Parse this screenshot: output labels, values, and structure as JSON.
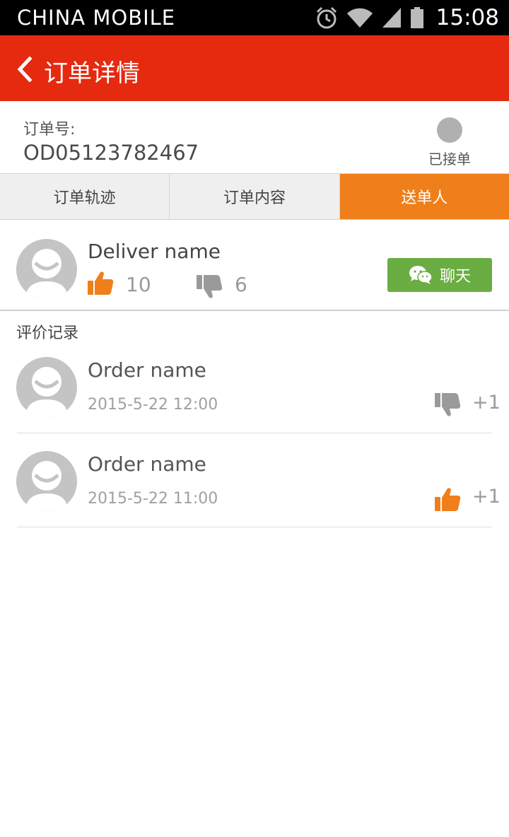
{
  "status_bar": {
    "carrier": "CHINA  MOBILE",
    "time": "15:08",
    "icons": [
      "alarm-icon",
      "wifi-icon",
      "signal-icon",
      "battery-icon"
    ]
  },
  "app_bar": {
    "title": "订单详情",
    "back_icon": "chevron-left-icon",
    "color": "#e52a10"
  },
  "order": {
    "label": "订单号:",
    "number": "OD05123782467",
    "status": "已接单"
  },
  "tabs": [
    {
      "label": "订单轨迹",
      "active": false
    },
    {
      "label": "订单内容",
      "active": false
    },
    {
      "label": "送单人",
      "active": true
    }
  ],
  "tab_active_color": "#ef7f1a",
  "deliverer": {
    "name": "Deliver name",
    "likes": "10",
    "dislikes": "6",
    "chat_label": "聊天",
    "chat_color": "#6aad42"
  },
  "reviews": {
    "title": "评价记录",
    "items": [
      {
        "name": "Order name",
        "time": "2015-5-22  12:00",
        "rating": "dislike",
        "score": "+1"
      },
      {
        "name": "Order name",
        "time": "2015-5-22  11:00",
        "rating": "like",
        "score": "+1"
      }
    ]
  }
}
